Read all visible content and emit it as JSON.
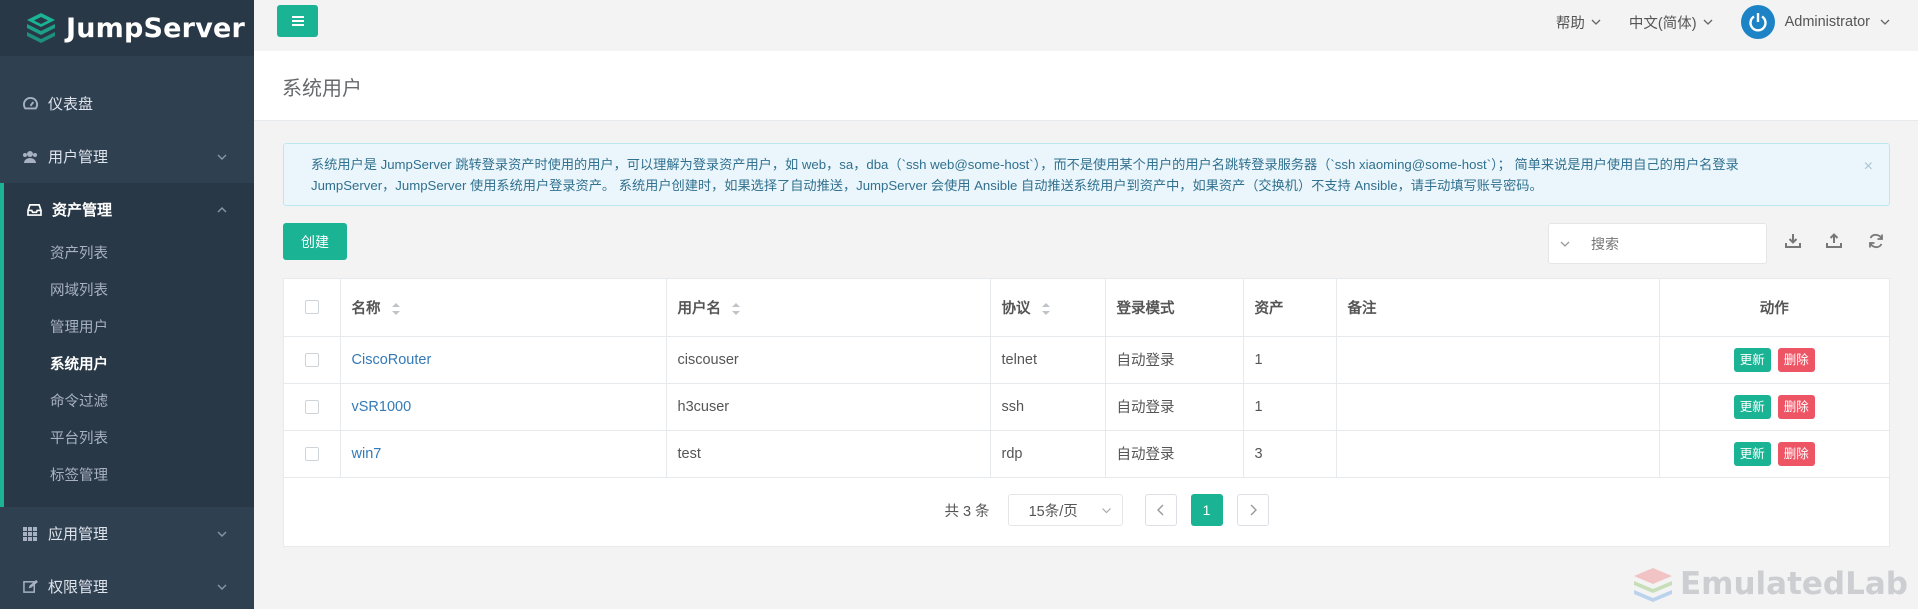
{
  "brand": {
    "name": "JumpServer"
  },
  "sidebar": {
    "items": [
      {
        "label": "仪表盘",
        "icon": "dashboard-icon"
      },
      {
        "label": "用户管理",
        "icon": "users-icon"
      },
      {
        "label": "资产管理",
        "icon": "inbox-icon",
        "expanded": true
      },
      {
        "label": "应用管理",
        "icon": "grid-icon"
      },
      {
        "label": "权限管理",
        "icon": "edit-icon"
      }
    ],
    "asset_sub": [
      {
        "label": "资产列表"
      },
      {
        "label": "网域列表"
      },
      {
        "label": "管理用户"
      },
      {
        "label": "系统用户",
        "active": true
      },
      {
        "label": "命令过滤"
      },
      {
        "label": "平台列表"
      },
      {
        "label": "标签管理"
      }
    ]
  },
  "topbar": {
    "help": "帮助",
    "language": "中文(简体)",
    "user": "Administrator"
  },
  "page": {
    "title": "系统用户"
  },
  "alert": {
    "line1": "系统用户是 JumpServer 跳转登录资产时使用的用户，可以理解为登录资产用户，如 web，sa，dba（`ssh web@some-host`），而不是使用某个用户的用户名跳转登录服务器（`ssh xiaoming@some-host`）； 简单来说是用户使用自己的用户名登录",
    "line2": "JumpServer，JumpServer 使用系统用户登录资产。 系统用户创建时，如果选择了自动推送，JumpServer 会使用 Ansible 自动推送系统用户到资产中，如果资产（交换机）不支持 Ansible，请手动填写账号密码。",
    "close": "×"
  },
  "toolbar": {
    "create_label": "创建",
    "search_placeholder": "搜索"
  },
  "table": {
    "headers": {
      "name": "名称",
      "username": "用户名",
      "protocol": "协议",
      "login_mode": "登录模式",
      "assets": "资产",
      "comment": "备注",
      "actions": "动作"
    },
    "rows": [
      {
        "name": "CiscoRouter",
        "username": "ciscouser",
        "protocol": "telnet",
        "login_mode": "自动登录",
        "assets": "1",
        "comment": ""
      },
      {
        "name": "vSR1000",
        "username": "h3cuser",
        "protocol": "ssh",
        "login_mode": "自动登录",
        "assets": "1",
        "comment": ""
      },
      {
        "name": "win7",
        "username": "test",
        "protocol": "rdp",
        "login_mode": "自动登录",
        "assets": "3",
        "comment": ""
      }
    ],
    "update_label": "更新",
    "delete_label": "删除"
  },
  "pagination": {
    "total": "共 3 条",
    "per_page": "15条/页",
    "current": "1"
  },
  "watermark": {
    "text": "EmulatedLab"
  },
  "colors": {
    "sidebar_bg": "#2f4050",
    "accent": "#1ab394",
    "danger": "#ed5565",
    "link": "#337ab7",
    "alert_bg": "#eaf6fb",
    "avatar": "#1c84c6"
  }
}
